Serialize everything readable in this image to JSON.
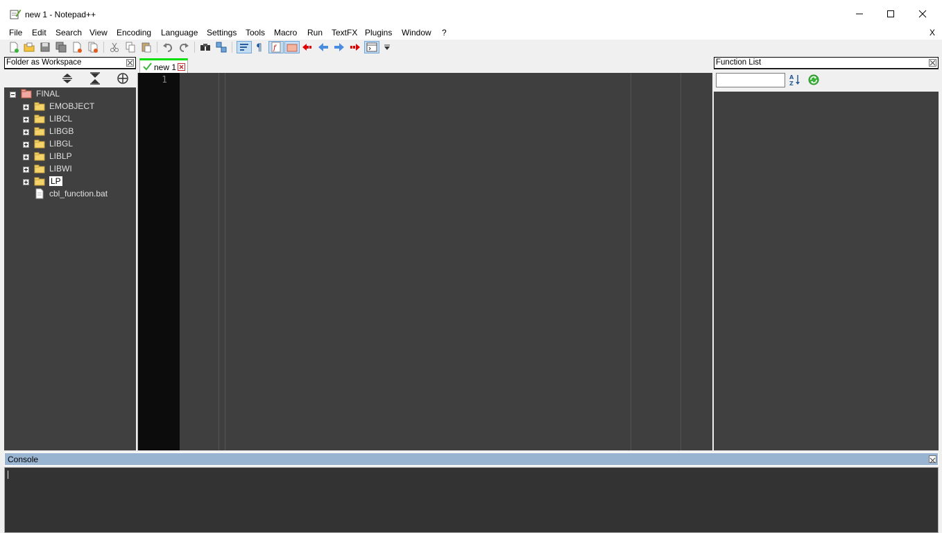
{
  "window": {
    "title": "new 1 - Notepad++",
    "controls": [
      "minimize",
      "maximize",
      "close"
    ]
  },
  "menubar": {
    "items": [
      {
        "label": "File"
      },
      {
        "label": "Edit"
      },
      {
        "label": "Search"
      },
      {
        "label": "View"
      },
      {
        "label": "Encoding"
      },
      {
        "label": "Language"
      },
      {
        "label": "Settings"
      },
      {
        "label": "Tools"
      },
      {
        "label": "Macro"
      },
      {
        "label": "Run"
      },
      {
        "label": "TextFX"
      },
      {
        "label": "Plugins"
      },
      {
        "label": "Window"
      },
      {
        "label": "?"
      }
    ],
    "close_doc": "X"
  },
  "toolbar": {
    "icons": [
      "new-file-icon",
      "open-file-icon",
      "save-icon",
      "save-all-icon",
      "close-icon",
      "close-all-icon",
      "cut-icon",
      "copy-icon",
      "paste-icon",
      "undo-icon",
      "redo-icon",
      "find-icon",
      "replace-icon",
      "wrap-icon",
      "show-all-chars-icon",
      "function-list-icon",
      "folder-workspace-icon",
      "macro-record-icon",
      "back-icon",
      "forward-icon",
      "macro-play-icon",
      "panel-icon",
      "dropdown-icon"
    ]
  },
  "left_panel": {
    "caption": "Folder as Workspace",
    "tree": {
      "root": "FINAL",
      "children": [
        {
          "label": "EMOBJECT",
          "type": "folder"
        },
        {
          "label": "LIBCL",
          "type": "folder"
        },
        {
          "label": "LIBGB",
          "type": "folder"
        },
        {
          "label": "LIBGL",
          "type": "folder"
        },
        {
          "label": "LIBLP",
          "type": "folder"
        },
        {
          "label": "LIBWI",
          "type": "folder"
        },
        {
          "label": "LP",
          "type": "folder",
          "selected": true
        },
        {
          "label": "cbl_function.bat",
          "type": "file"
        }
      ]
    }
  },
  "editor": {
    "tab_label": "new 1",
    "line_number": "1",
    "colors": {
      "gutter": "#0c0c0c",
      "background": "#3f3f3f",
      "tab_indicator": "#00e000"
    }
  },
  "right_panel": {
    "caption": "Function List",
    "search_value": ""
  },
  "console": {
    "caption": "Console"
  }
}
